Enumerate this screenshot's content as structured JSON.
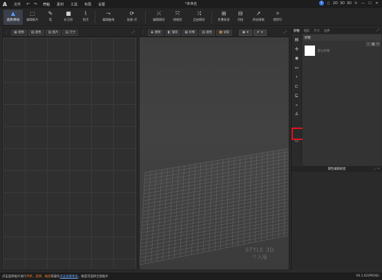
{
  "app": {
    "window_title": "*未命名",
    "logo": "A"
  },
  "menu": {
    "items": [
      "文件",
      "开始",
      "素材",
      "工具",
      "布局",
      "设置"
    ],
    "active": "开始",
    "undo_icon": "undo-icon",
    "redo_icon": "redo-icon",
    "right": {
      "badge": "1",
      "btn_2d": "2D",
      "btn_3d": "3D",
      "btn_3d2": "3D"
    }
  },
  "toolbar": {
    "tools": [
      {
        "label": "选择/移动",
        "icon": "cursor-icon",
        "glyph": "▲",
        "selected": true
      },
      {
        "label": "编辑板片",
        "icon": "edit-pattern-icon",
        "glyph": "⬚"
      },
      {
        "label": "笔",
        "icon": "pen-icon",
        "glyph": "✎"
      },
      {
        "label": "长方形",
        "icon": "rectangle-icon",
        "glyph": "■"
      },
      {
        "label": "抓点",
        "icon": "point-icon",
        "glyph": "⌇"
      },
      {
        "label": "编辑曲线",
        "icon": "curve-icon",
        "glyph": "⤳"
      },
      {
        "label": "层级-点",
        "icon": "layer-point-icon",
        "glyph": "⟳"
      },
      {
        "label": "编辑缝纫",
        "icon": "sew-edit-icon",
        "glyph": "⤫"
      },
      {
        "label": "线缝纫",
        "icon": "line-sew-icon",
        "glyph": "⤧"
      },
      {
        "label": "自由缝纫",
        "icon": "free-sew-icon",
        "glyph": "⤨"
      },
      {
        "label": "折叠安排",
        "icon": "fold-icon",
        "glyph": "⊞"
      },
      {
        "label": "归拢",
        "icon": "gather-icon",
        "glyph": "⊟"
      },
      {
        "label": "添加褶裥",
        "icon": "pleat-icon",
        "glyph": "↗"
      },
      {
        "label": "褶饰针",
        "icon": "smock-icon",
        "glyph": "✧"
      }
    ]
  },
  "pane2d": {
    "buttons": [
      {
        "label": "组物",
        "icon": "group-icon",
        "glyph": "▦"
      },
      {
        "label": "颜色",
        "icon": "color-icon",
        "glyph": "▧"
      },
      {
        "label": "板片",
        "icon": "pattern-icon",
        "glyph": "▥"
      },
      {
        "label": "尺寸",
        "icon": "size-icon",
        "glyph": "▤"
      }
    ]
  },
  "pane3d": {
    "buttons": [
      {
        "label": "模特",
        "icon": "avatar-icon",
        "glyph": "♟"
      },
      {
        "label": "服装",
        "icon": "garment-icon",
        "glyph": "◧"
      },
      {
        "label": "织物",
        "icon": "fabric-icon",
        "glyph": "▦"
      },
      {
        "label": "颜色",
        "icon": "color-icon",
        "glyph": "▧"
      },
      {
        "label": "试穿",
        "icon": "fit-icon",
        "glyph": "▩"
      }
    ],
    "watermark_line1": "STYLE 3D",
    "watermark_line2": "个人版"
  },
  "rpanel": {
    "tabs": [
      "织物",
      "纽扣",
      "尺寸",
      "边界"
    ],
    "active_tab": "织物",
    "list_header": "织物",
    "fabric_name": "默认织物",
    "fabric_color": "#ffffff",
    "prop_title": "属性编辑视窗",
    "side_icons": [
      "fabric-icon",
      "button-icon",
      "buttonhole-icon",
      "trim-icon",
      "zipper-icon",
      "seam-icon",
      "tape-icon",
      "elastic-icon",
      "hanger-icon",
      "print-icon"
    ],
    "highlight_color": "#e0141e"
  },
  "status": {
    "prefix": "点击选择板片进行",
    "w1": "平移",
    "sep1": "、",
    "w2": "旋转",
    "sep2": "、",
    "w3": "缩放",
    "mid": "等操作",
    "link": "点击查看更多",
    "suffix": "，框选可选择全部板片",
    "version": "V6.1.62(PROD)"
  }
}
